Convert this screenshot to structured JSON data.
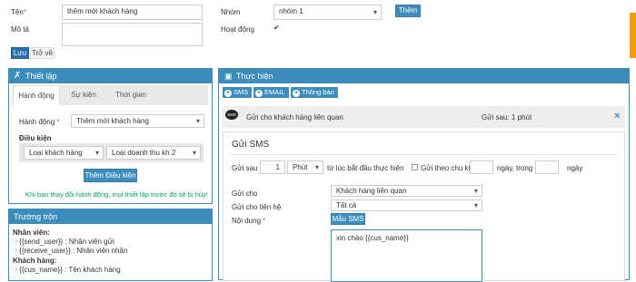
{
  "top_form": {
    "name_label": "Tên",
    "name_required": "*",
    "name_value": "thêm mới khách hàng",
    "desc_label": "Mô tả",
    "desc_value": "",
    "group_label": "Nhóm",
    "group_value": "nhóm 1",
    "add_button": "Thêm",
    "active_label": "Hoạt động",
    "active_checked": true,
    "save_button": "Lưu",
    "back_button": "Trở về"
  },
  "setup_panel": {
    "title": "Thiết lập",
    "tabs": [
      {
        "label": "Hành động",
        "active": true
      },
      {
        "label": "Sự kiện",
        "active": false
      },
      {
        "label": "Thời gian",
        "active": false
      }
    ],
    "action_label": "Hành động",
    "action_required": "*",
    "action_value": "Thêm mới khách hàng",
    "conditions_label": "Điều kiện",
    "condition_1": "Loại khách hàng",
    "condition_2": "Loại doanh thu kh 2",
    "add_condition_button": "Thêm Điều kiện",
    "warning": "Khi bạn thay đổi hành động, mọi thiết lập trước đó sẽ bị hủy!"
  },
  "fields_panel": {
    "title": "Trường trộn",
    "staff_heading": "Nhân viên:",
    "staff_items": [
      {
        "code": "{{send_user}}",
        "desc": ": Nhân viên gửi"
      },
      {
        "code": "{{receive_user}}",
        "desc": ": Nhân viên nhận"
      }
    ],
    "customer_heading": "Khách hàng:",
    "customer_items": [
      {
        "code": "{{cus_name}}",
        "desc": ": Tên khách hàng"
      }
    ]
  },
  "exec_panel": {
    "title": "Thực hiện",
    "chips": [
      "SMS",
      "EMAIL",
      "Thông báo"
    ],
    "list_item": {
      "icon_text": "SMS",
      "title": "Gửi cho khách hàng liên quan",
      "delay": "Gửi sau: 1 phút",
      "close": "×"
    }
  },
  "sms_form": {
    "heading": "Gửi SMS",
    "send_after_label": "Gửi sau",
    "send_after_value": "1",
    "unit_value": "Phút",
    "from_label": "từ lúc bắt đầu thực hiện",
    "periodic_label": "Gửi theo chu kì",
    "periodic_checked": false,
    "period_value": "",
    "days_label": "ngày,",
    "within_label": "trong",
    "within_value": "",
    "days2_label": "ngày",
    "send_to_label": "Gửi cho",
    "send_to_value": "Khách hàng liên quan",
    "contact_label": "Gửi cho liên hệ",
    "contact_value": "Tất cả",
    "content_label": "Nội dung",
    "content_required": "*",
    "template_button": "Mẫu SMS",
    "content_value": "xin chào {{cus_name}}"
  },
  "colors": {
    "primary": "#3c8dbc",
    "success_text": "#00a65a",
    "danger": "#d9534f",
    "side_tab": "#f39c12"
  }
}
